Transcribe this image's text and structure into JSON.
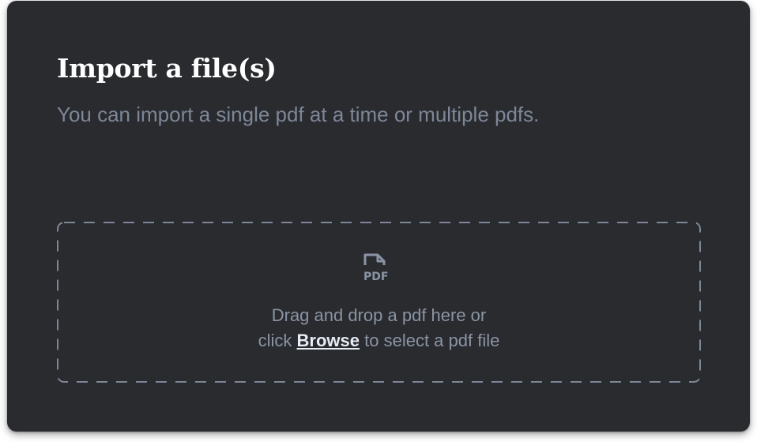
{
  "dialog": {
    "title": "Import a file(s)",
    "description": "You can import a single pdf at a time or multiple pdfs."
  },
  "dropzone": {
    "icon": "pdf-file-icon",
    "icon_text": "PDF",
    "line1": "Drag and drop a pdf here or",
    "line2_prefix": "click ",
    "browse_label": "Browse",
    "line2_suffix": " to select a pdf file"
  },
  "colors": {
    "card_background": "#2a2b2f",
    "title": "#ffffff",
    "muted_text": "#7d8797",
    "link": "#e6ecf5",
    "dash_border": "#7d8797"
  }
}
